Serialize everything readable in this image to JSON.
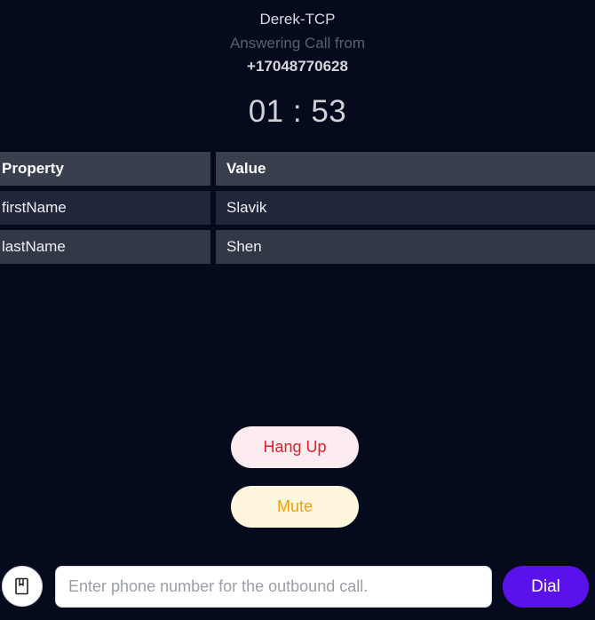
{
  "call": {
    "caller_name": "Derek-TCP",
    "status": "Answering Call from",
    "number": "+17048770628",
    "timer": "01 : 53"
  },
  "properties_table": {
    "headers": [
      "Property",
      "Value"
    ],
    "rows": [
      [
        "firstName",
        "Slavik"
      ],
      [
        "lastName",
        "Shen"
      ]
    ]
  },
  "actions": {
    "hang_up_label": "Hang Up",
    "mute_label": "Mute"
  },
  "dialer": {
    "contacts_icon": "book-icon",
    "input_value": "",
    "input_placeholder": "Enter phone number for the outbound call.",
    "dial_label": "Dial"
  },
  "colors": {
    "background": "#060a1d",
    "hang_up_text": "#e11d2c",
    "hang_up_bg": "#fdecef",
    "mute_text": "#e9a20a",
    "mute_bg": "#fdf6dc",
    "dial_bg": "#5b12ea"
  }
}
